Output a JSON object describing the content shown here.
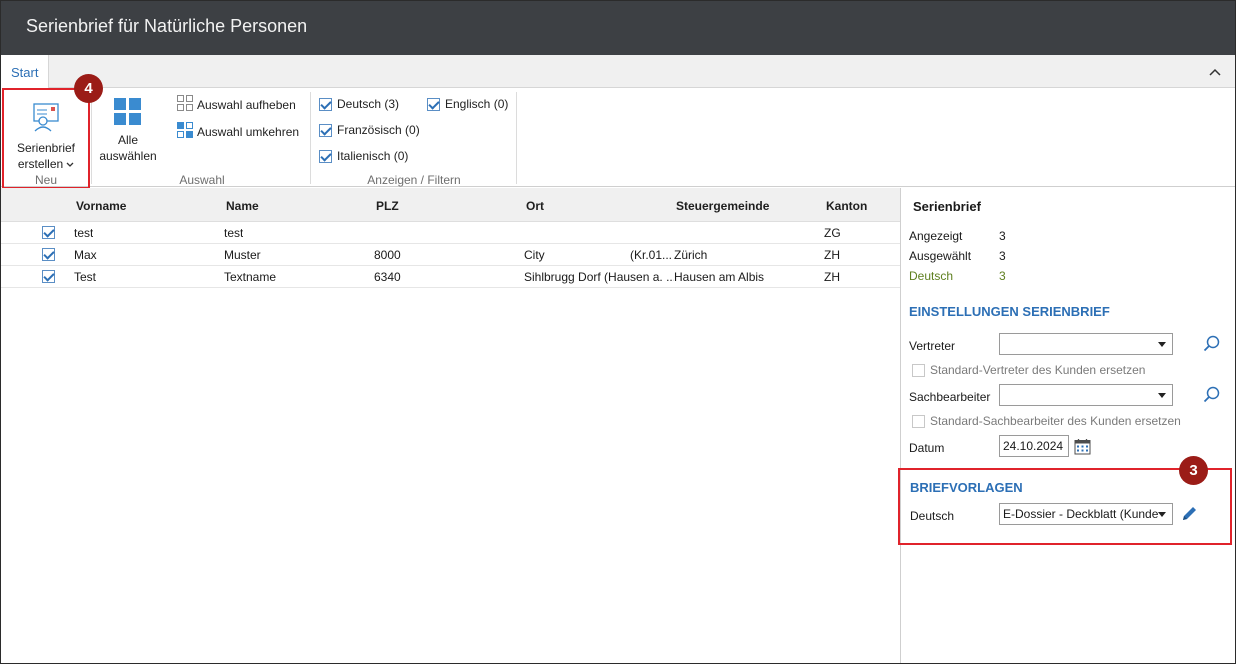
{
  "window": {
    "title": "Serienbrief für Natürliche Personen"
  },
  "tabs": {
    "start": "Start",
    "collapse_icon": "chevron-up-icon"
  },
  "ribbon": {
    "neu": {
      "create_label_line1": "Serienbrief",
      "create_label_line2": "erstellen",
      "group_label": "Neu"
    },
    "auswahl": {
      "select_all_line1": "Alle",
      "select_all_line2": "auswählen",
      "clear_selection": "Auswahl aufheben",
      "invert_selection": "Auswahl umkehren",
      "group_label": "Auswahl"
    },
    "filter": {
      "deutsch": "Deutsch (3)",
      "englisch": "Englisch (0)",
      "franzoesisch": "Französisch (0)",
      "italienisch": "Italienisch (0)",
      "group_label": "Anzeigen / Filtern"
    }
  },
  "badges": {
    "ribbon": "4",
    "panel": "3"
  },
  "grid": {
    "columns": [
      "Vorname",
      "Name",
      "PLZ",
      "Ort",
      "Steuergemeinde",
      "Kanton"
    ],
    "rows": [
      {
        "checked": true,
        "vorname": "test",
        "name": "test",
        "plz": "",
        "ort": "",
        "ort_extra": "",
        "steuergemeinde": "",
        "kanton": "ZG"
      },
      {
        "checked": true,
        "vorname": "Max",
        "name": "Muster",
        "plz": "8000",
        "ort": "City",
        "ort_extra": "(Kr.01...",
        "steuergemeinde": "Zürich",
        "kanton": "ZH"
      },
      {
        "checked": true,
        "vorname": "Test",
        "name": "Textname",
        "plz": "6340",
        "ort": "Sihlbrugg Dorf (Hausen a. ...",
        "ort_extra": "",
        "steuergemeinde": "Hausen am Albis",
        "kanton": "ZH"
      }
    ]
  },
  "panel": {
    "title": "Serienbrief",
    "stats": {
      "angezeigt_label": "Angezeigt",
      "angezeigt_value": "3",
      "ausgewaehlt_label": "Ausgewählt",
      "ausgewaehlt_value": "3",
      "deutsch_label": "Deutsch",
      "deutsch_value": "3"
    },
    "settings": {
      "heading": "EINSTELLUNGEN SERIENBRIEF",
      "vertreter_label": "Vertreter",
      "vertreter_value": "",
      "replace_vertreter": "Standard-Vertreter des Kunden ersetzen",
      "sachbearbeiter_label": "Sachbearbeiter",
      "sachbearbeiter_value": "",
      "replace_sachbearbeiter": "Standard-Sachbearbeiter des Kunden ersetzen",
      "datum_label": "Datum",
      "datum_value": "24.10.2024"
    },
    "briefvorlagen": {
      "heading": "BRIEFVORLAGEN",
      "deutsch_label": "Deutsch",
      "deutsch_value": "E-Dossier - Deckblatt (Kunde"
    }
  },
  "colors": {
    "accent": "#2c6fb5",
    "highlight": "#e0232b",
    "badge": "#9b1c17",
    "titlebar": "#3d4044",
    "green": "#5e7f1f"
  }
}
